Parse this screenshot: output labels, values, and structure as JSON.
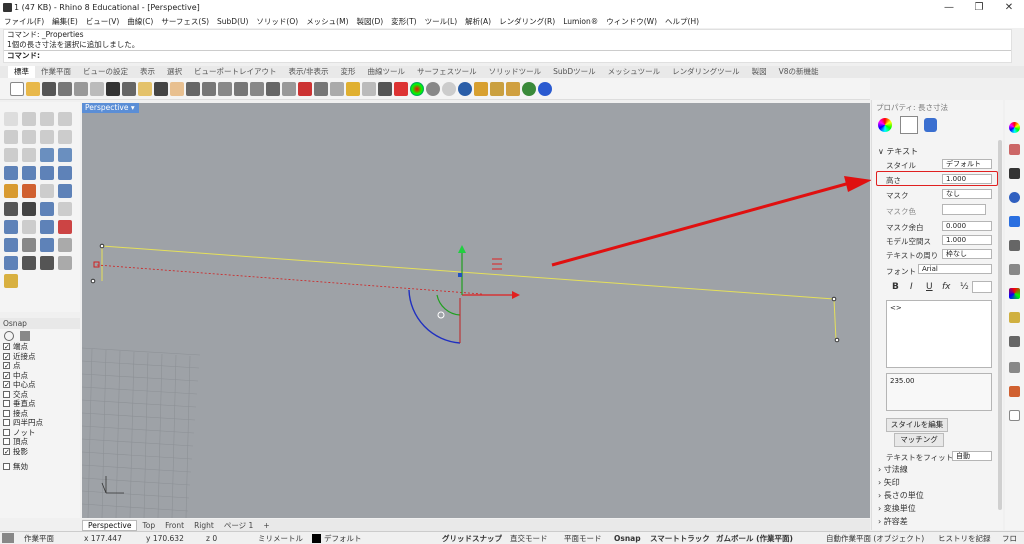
{
  "titlebar": {
    "title": "1 (47 KB) - Rhino 8 Educational - [Perspective]",
    "minimize": "—",
    "restore": "❐",
    "close": "✕"
  },
  "menu": [
    "ファイル(F)",
    "編集(E)",
    "ビュー(V)",
    "曲線(C)",
    "サーフェス(S)",
    "SubD(U)",
    "ソリッド(O)",
    "メッシュ(M)",
    "製図(D)",
    "変形(T)",
    "ツール(L)",
    "解析(A)",
    "レンダリング(R)",
    "Lumion®",
    "ウィンドウ(W)",
    "ヘルプ(H)"
  ],
  "command": {
    "line1": "コマンド: _Properties",
    "line2": "1個の長さ寸法を選択に追加しました。",
    "prompt": "コマンド:"
  },
  "tabs": [
    "標準",
    "作業平面",
    "ビューの設定",
    "表示",
    "選択",
    "ビューポートレイアウト",
    "表示/非表示",
    "変形",
    "曲線ツール",
    "サーフェスツール",
    "ソリッドツール",
    "SubDツール",
    "メッシュツール",
    "レンダリングツール",
    "製図",
    "V8の新機能"
  ],
  "viewport": {
    "title": "Perspective ▾"
  },
  "osnap": {
    "header": "Osnap",
    "items": [
      {
        "label": "端点",
        "checked": "✓"
      },
      {
        "label": "近接点",
        "checked": "✓"
      },
      {
        "label": "点",
        "checked": "✓"
      },
      {
        "label": "中点",
        "checked": "✓"
      },
      {
        "label": "中心点",
        "checked": "✓"
      },
      {
        "label": "交点",
        "checked": ""
      },
      {
        "label": "垂直点",
        "checked": ""
      },
      {
        "label": "接点",
        "checked": ""
      },
      {
        "label": "四半円点",
        "checked": ""
      },
      {
        "label": "ノット",
        "checked": ""
      },
      {
        "label": "頂点",
        "checked": ""
      },
      {
        "label": "投影",
        "checked": "✓"
      }
    ],
    "disable": "無効"
  },
  "vptabs": [
    "Perspective",
    "Top",
    "Front",
    "Right",
    "ページ 1",
    "+"
  ],
  "props": {
    "header": "プロパティ: 長さ寸法",
    "section": "テキスト",
    "style_label": "スタイル",
    "style_value": "デフォルト",
    "height_label": "高さ",
    "height_value": "1.000",
    "mask_label": "マスク",
    "mask_value": "なし",
    "maskcolor_label": "マスク色",
    "maskmargin_label": "マスク余白",
    "maskmargin_value": "0.000",
    "modelspace_label": "モデル空間ス",
    "modelspace_value": "1.000",
    "frame_label": "テキストの周り",
    "frame_value": "枠なし",
    "font_label": "フォント",
    "font_value": "Arial",
    "fmt_bold": "B",
    "fmt_italic": "I",
    "fmt_underline": "U",
    "fmt_fx": "fx",
    "fmt_frac": "½",
    "text_value": "<>",
    "preview_value": "235.00",
    "edit_style": "スタイルを編集",
    "match": "マッチング",
    "fit_label": "テキストをフィット",
    "fit_value": "自動",
    "sections": [
      "寸法線",
      "矢印",
      "長さの単位",
      "変換単位",
      "許容差"
    ]
  },
  "status": {
    "cplane": "作業平面",
    "x": "x 177.447",
    "y": "y 170.632",
    "z": "z 0",
    "units": "ミリメートル",
    "layer": "デフォルト",
    "grid_snap": "グリッドスナップ",
    "ortho": "直交モード",
    "planar": "平面モード",
    "osnap": "Osnap",
    "smarttrack": "スマートトラック",
    "gumball": "ガムボール (作業平面)",
    "autocplane": "自動作業平面 (オブジェクト)",
    "history": "ヒストリを記録",
    "filter": "フロ"
  },
  "colors": {
    "accent": "#5b8ed6",
    "dimension": "#e5e05a",
    "arrow": "#e02020",
    "viewport_bg": "#9ea2a7"
  }
}
